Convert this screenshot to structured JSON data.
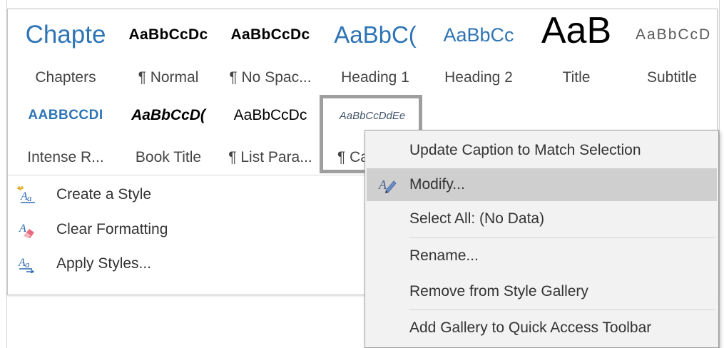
{
  "gallery": {
    "row1": [
      {
        "preview": "Chapte",
        "label": "Chapters"
      },
      {
        "preview": "AaBbCcDc",
        "label": "¶ Normal"
      },
      {
        "preview": "AaBbCcDc",
        "label": "¶ No Spac..."
      },
      {
        "preview": "AaBbC(",
        "label": "Heading 1"
      },
      {
        "preview": "AaBbCc",
        "label": "Heading 2"
      },
      {
        "preview": "AaB",
        "label": "Title"
      },
      {
        "preview": "AaBbCcD",
        "label": "Subtitle"
      }
    ],
    "row2": [
      {
        "preview": "AABBCCDI",
        "label": "Intense R..."
      },
      {
        "preview": "AaBbCcD(",
        "label": "Book Title"
      },
      {
        "preview": "AaBbCcDc",
        "label": "¶ List Para..."
      },
      {
        "preview": "AaBbCcDdEe",
        "label": "¶ Ca"
      }
    ],
    "commands": [
      {
        "icon": "create-style-icon",
        "label": "Create a Style"
      },
      {
        "icon": "eraser-icon",
        "label": "Clear Formatting"
      },
      {
        "icon": "apply-styles-icon",
        "label": "Apply Styles..."
      }
    ]
  },
  "context_menu": {
    "items": [
      {
        "label": "Update Caption to Match Selection",
        "icon": "",
        "highlighted": false
      },
      {
        "label": "Modify...",
        "icon": "modify-pen-icon",
        "highlighted": true
      },
      {
        "label": "Select All: (No Data)",
        "icon": "",
        "highlighted": false
      },
      {
        "label": "Rename...",
        "icon": "",
        "highlighted": false
      },
      {
        "label": "Remove from Style Gallery",
        "icon": "",
        "highlighted": false
      },
      {
        "label": "Add Gallery to Quick Access Toolbar",
        "icon": "",
        "highlighted": false
      }
    ]
  },
  "colors": {
    "heading_blue": "#2e74b5",
    "menu_background": "#f2f2f2",
    "menu_highlight": "#cfcfcf",
    "selection_frame": "#9e9e9e"
  }
}
